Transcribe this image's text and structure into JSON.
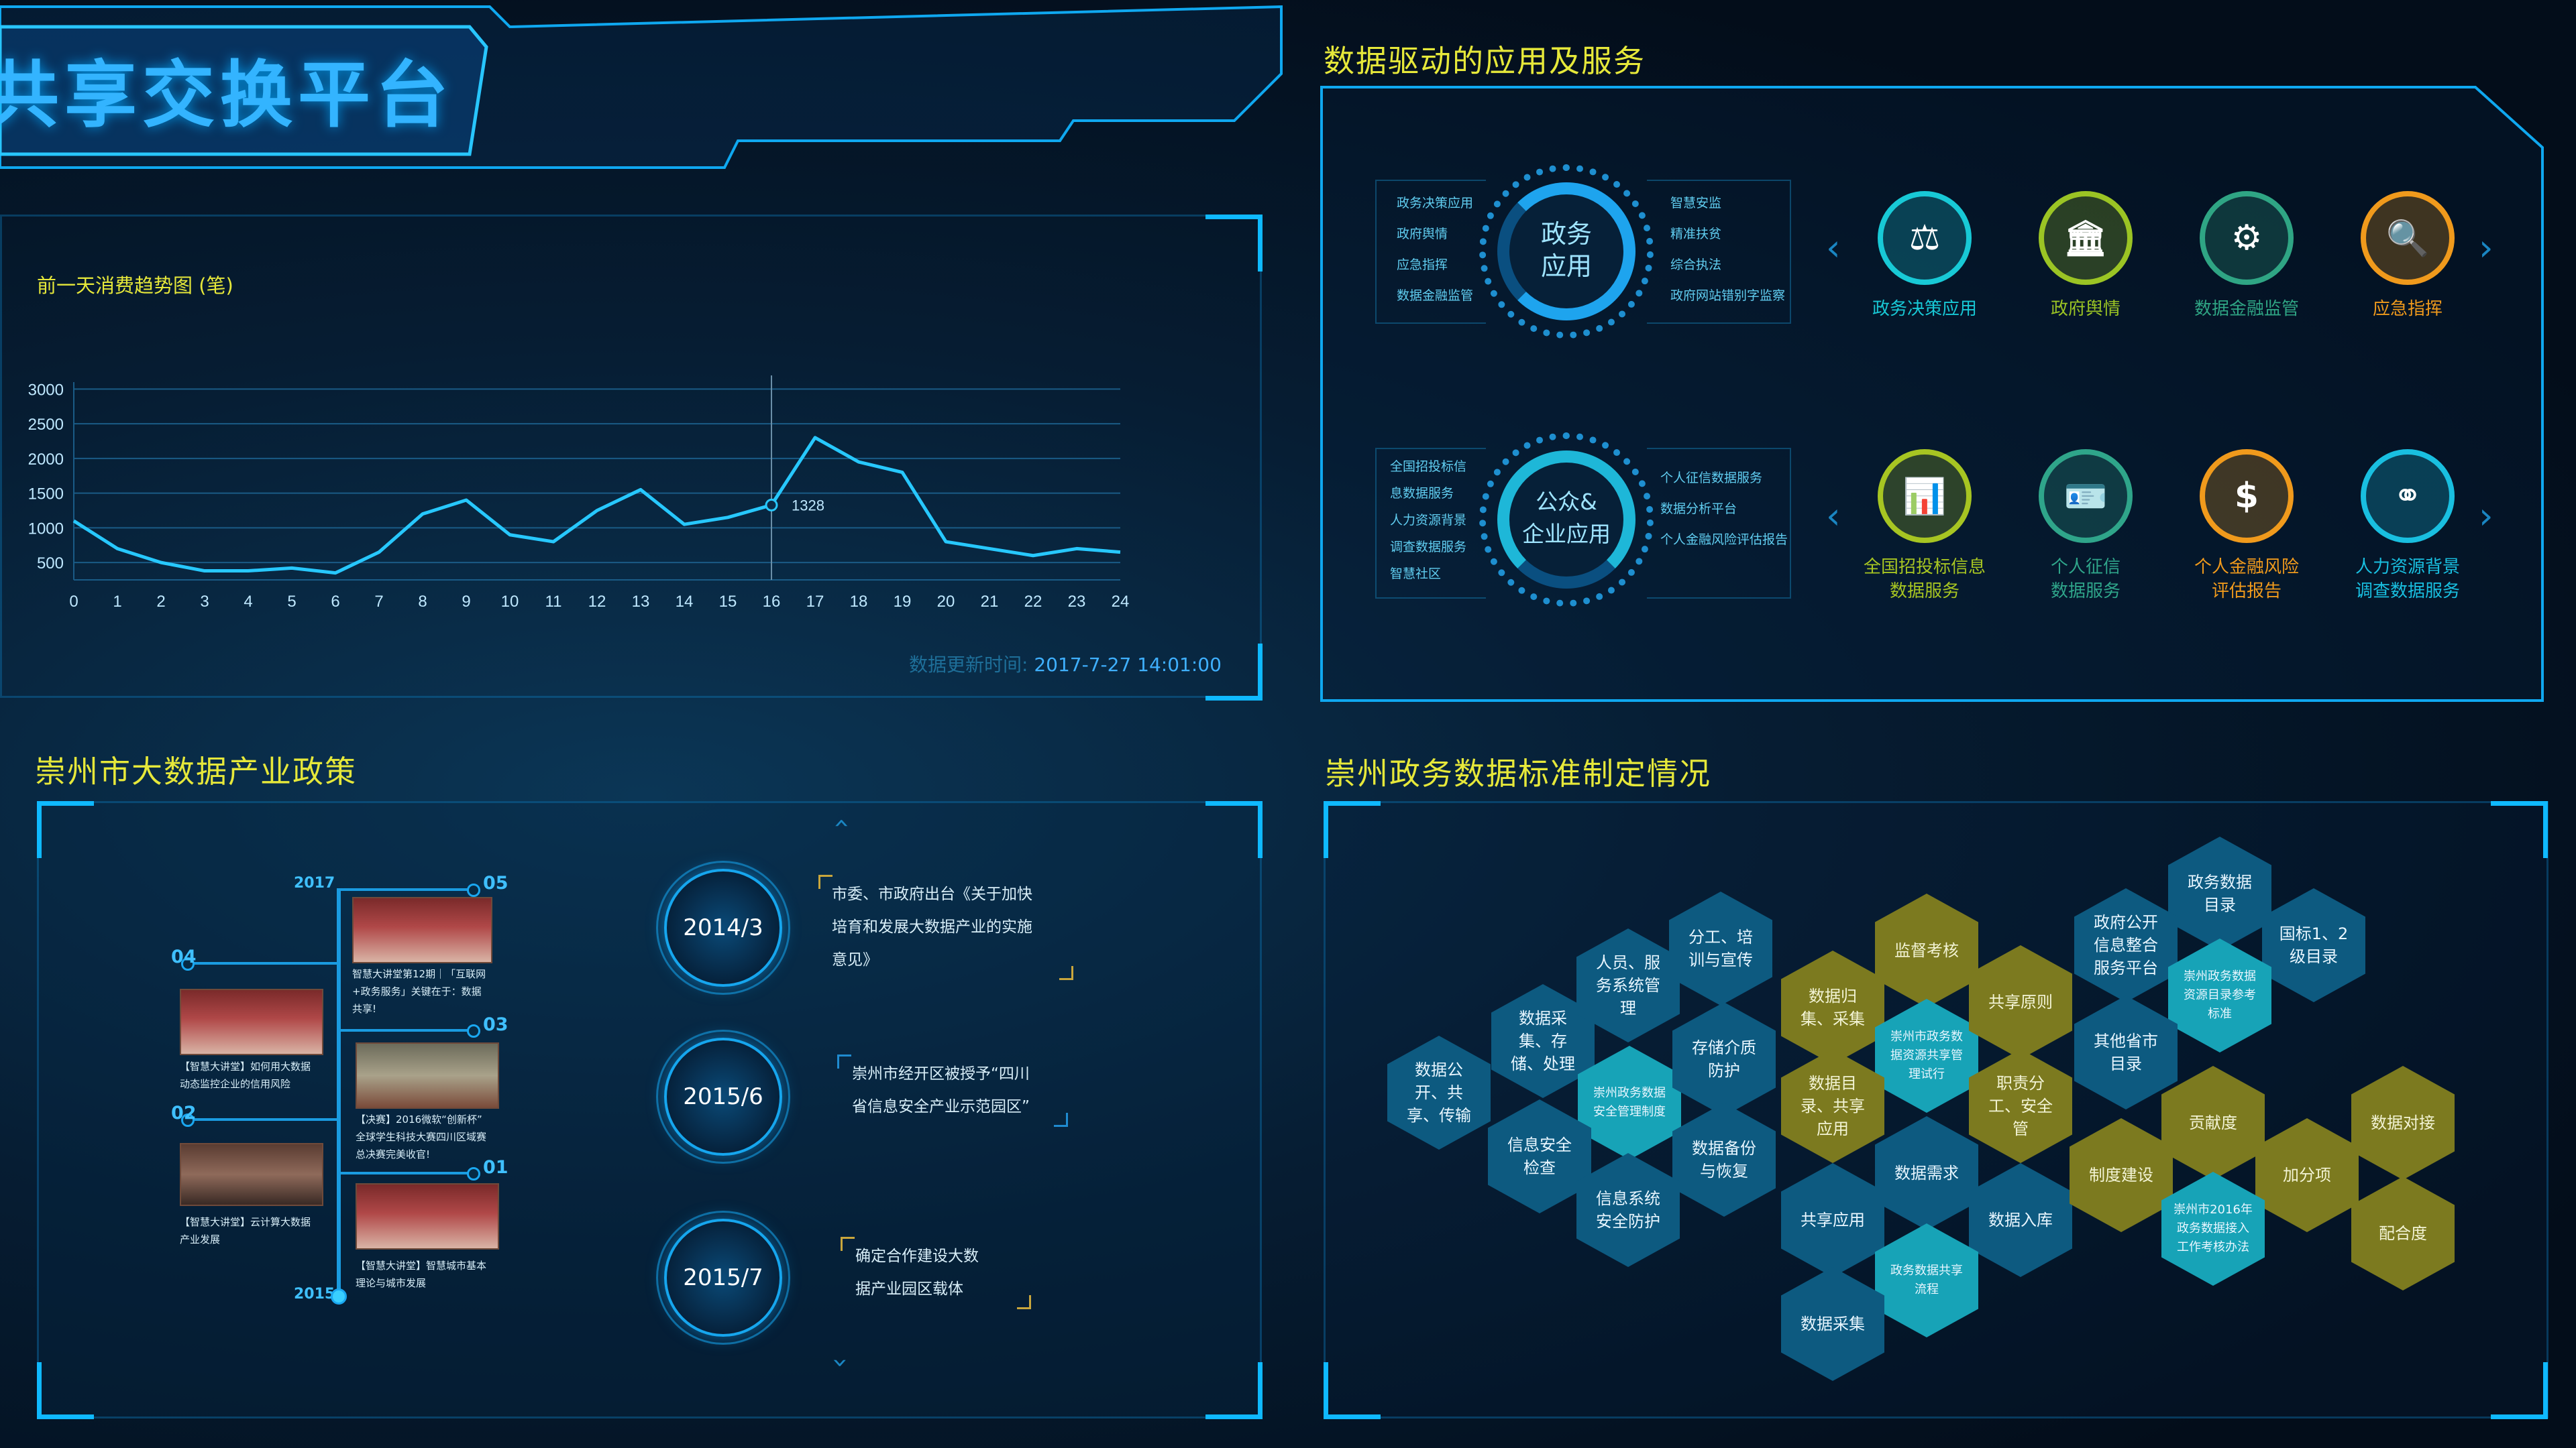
{
  "header": {
    "title": "共享交换平台"
  },
  "trend_panel": {
    "title": "前一天消费趋势图 (笔)",
    "update_label": "数据更新时间:",
    "update_time": "2017-7-27  14:01:00",
    "highlight_value": "1328"
  },
  "chart_data": {
    "type": "line",
    "title": "前一天消费趋势图 (笔)",
    "x": [
      0,
      1,
      2,
      3,
      4,
      5,
      6,
      7,
      8,
      9,
      10,
      11,
      12,
      13,
      14,
      15,
      16,
      17,
      18,
      19,
      20,
      21,
      22,
      23,
      24
    ],
    "series": [
      {
        "values": [
          1100,
          700,
          500,
          380,
          380,
          420,
          350,
          650,
          1200,
          1400,
          900,
          800,
          1250,
          1550,
          1050,
          1150,
          1328,
          2300,
          1950,
          1800,
          800,
          700,
          600,
          700,
          650
        ]
      }
    ],
    "yticks": [
      500,
      1000,
      1500,
      2000,
      2500,
      3000
    ],
    "ylim": [
      250,
      3100
    ],
    "grid": true,
    "highlight": {
      "x": 16,
      "label": "1328"
    }
  },
  "apps_panel": {
    "title": "数据驱动的应用及服务",
    "ring1": {
      "label_line1": "政务",
      "label_line2": "应用",
      "left_items": [
        "政务决策应用",
        "政府舆情",
        "应急指挥",
        "数据金融监管"
      ],
      "right_items": [
        "智慧安监",
        "精准扶贫",
        "综合执法",
        "政府网站错别字监察"
      ]
    },
    "ring2": {
      "label_line1": "公众&",
      "label_line2": "企业应用",
      "left_items": [
        "全国招投标信",
        "息数据服务",
        "人力资源背景",
        "调查数据服务",
        "智慧社区"
      ],
      "right_items": [
        "个人征信数据服务",
        "数据分析平台",
        "个人金融风险评估报告"
      ]
    },
    "row1": [
      {
        "label": "政务决策应用",
        "icon": "gavel-icon",
        "glyph": "⚖",
        "color": "#18c9d6"
      },
      {
        "label": "政府舆情",
        "icon": "government-building-icon",
        "glyph": "🏛",
        "color": "#9bc424"
      },
      {
        "label": "数据金融监管",
        "icon": "finance-gear-icon",
        "glyph": "⚙",
        "color": "#2fa584"
      },
      {
        "label": "应急指挥",
        "icon": "search-alert-icon",
        "glyph": "🔍",
        "color": "#f09a1c"
      }
    ],
    "row2": [
      {
        "label1": "全国招投标信息",
        "label2": "数据服务",
        "icon": "bar-chart-icon",
        "glyph": "📊",
        "color": "#a7c522"
      },
      {
        "label1": "个人征信",
        "label2": "数据服务",
        "icon": "id-card-icon",
        "glyph": "🪪",
        "color": "#2fa58a"
      },
      {
        "label1": "个人金融风险",
        "label2": "评估报告",
        "icon": "coin-icon",
        "glyph": "$",
        "color": "#f09a1c"
      },
      {
        "label1": "人力资源背景",
        "label2": "调查数据服务",
        "icon": "network-icon",
        "glyph": "⚭",
        "color": "#19bfe0"
      }
    ]
  },
  "policy_panel": {
    "title": "崇州市大数据产业政策",
    "years": {
      "top": "2017",
      "bottom": "2015"
    },
    "nodes": [
      "05",
      "04",
      "03",
      "02",
      "01"
    ],
    "captions": {
      "n05": [
        "智慧大讲堂第12期｜「互联网",
        "+政务服务」关键在于：数据",
        "共享!"
      ],
      "n04": [
        "【智慧大讲堂】如何用大数据",
        "动态监控企业的信用风险"
      ],
      "n03": [
        "【决赛】2016微软“创新杯”",
        "全球学生科技大赛四川区域赛",
        "总决赛完美收官!"
      ],
      "n02": [
        "【智慧大讲堂】云计算大数据",
        "产业发展"
      ],
      "n01": [
        "【智慧大讲堂】智慧城市基本",
        "理论与城市发展"
      ]
    },
    "events": [
      {
        "date": "2014/3",
        "lines": [
          "市委、市政府出台《关于加快",
          "培育和发展大数据产业的实施",
          "意见》"
        ]
      },
      {
        "date": "2015/6",
        "lines": [
          "崇州市经开区被授予“四川",
          "省信息安全产业示范园区”"
        ]
      },
      {
        "date": "2015/7",
        "lines": [
          "确定合作建设大数",
          "据产业园区载体"
        ]
      }
    ]
  },
  "standards_panel": {
    "title": "崇州政务数据标准制定情况",
    "hexes": [
      {
        "text": "数据公开、共享、传输",
        "c": "b"
      },
      {
        "text": "数据采集、存储、处理",
        "c": "b"
      },
      {
        "text": "人员、服务系统管理",
        "c": "b"
      },
      {
        "text": "分工、培训与宣传",
        "c": "b"
      },
      {
        "text": "崇州政务数据安全管理制度",
        "c": "t"
      },
      {
        "text": "存储介质防护",
        "c": "b"
      },
      {
        "text": "信息安全检查",
        "c": "b"
      },
      {
        "text": "数据备份与恢复",
        "c": "b"
      },
      {
        "text": "信息系统安全防护",
        "c": "b"
      },
      {
        "text": "数据归集、采集",
        "c": "o"
      },
      {
        "text": "监督考核",
        "c": "o"
      },
      {
        "text": "崇州市政务数据资源共享管理试行",
        "c": "t"
      },
      {
        "text": "共享原则",
        "c": "o"
      },
      {
        "text": "数据目录、共享应用",
        "c": "o"
      },
      {
        "text": "职责分工、安全管",
        "c": "o"
      },
      {
        "text": "数据需求",
        "c": "b"
      },
      {
        "text": "共享应用",
        "c": "b"
      },
      {
        "text": "数据入库",
        "c": "b"
      },
      {
        "text": "政务数据共享流程",
        "c": "t"
      },
      {
        "text": "数据采集",
        "c": "b"
      },
      {
        "text": "政务数据目录",
        "c": "b"
      },
      {
        "text": "政府公开信息整合服务平台",
        "c": "b"
      },
      {
        "text": "国标1、2级目录",
        "c": "b"
      },
      {
        "text": "崇州政务数据资源目录参考标准",
        "c": "t"
      },
      {
        "text": "其他省市目录",
        "c": "b"
      },
      {
        "text": "贡献度",
        "c": "o"
      },
      {
        "text": "数据对接",
        "c": "o"
      },
      {
        "text": "制度建设",
        "c": "o"
      },
      {
        "text": "加分项",
        "c": "o"
      },
      {
        "text": "崇州市2016年政务数据接入工作考核办法",
        "c": "t"
      },
      {
        "text": "配合度",
        "c": "o"
      }
    ]
  }
}
